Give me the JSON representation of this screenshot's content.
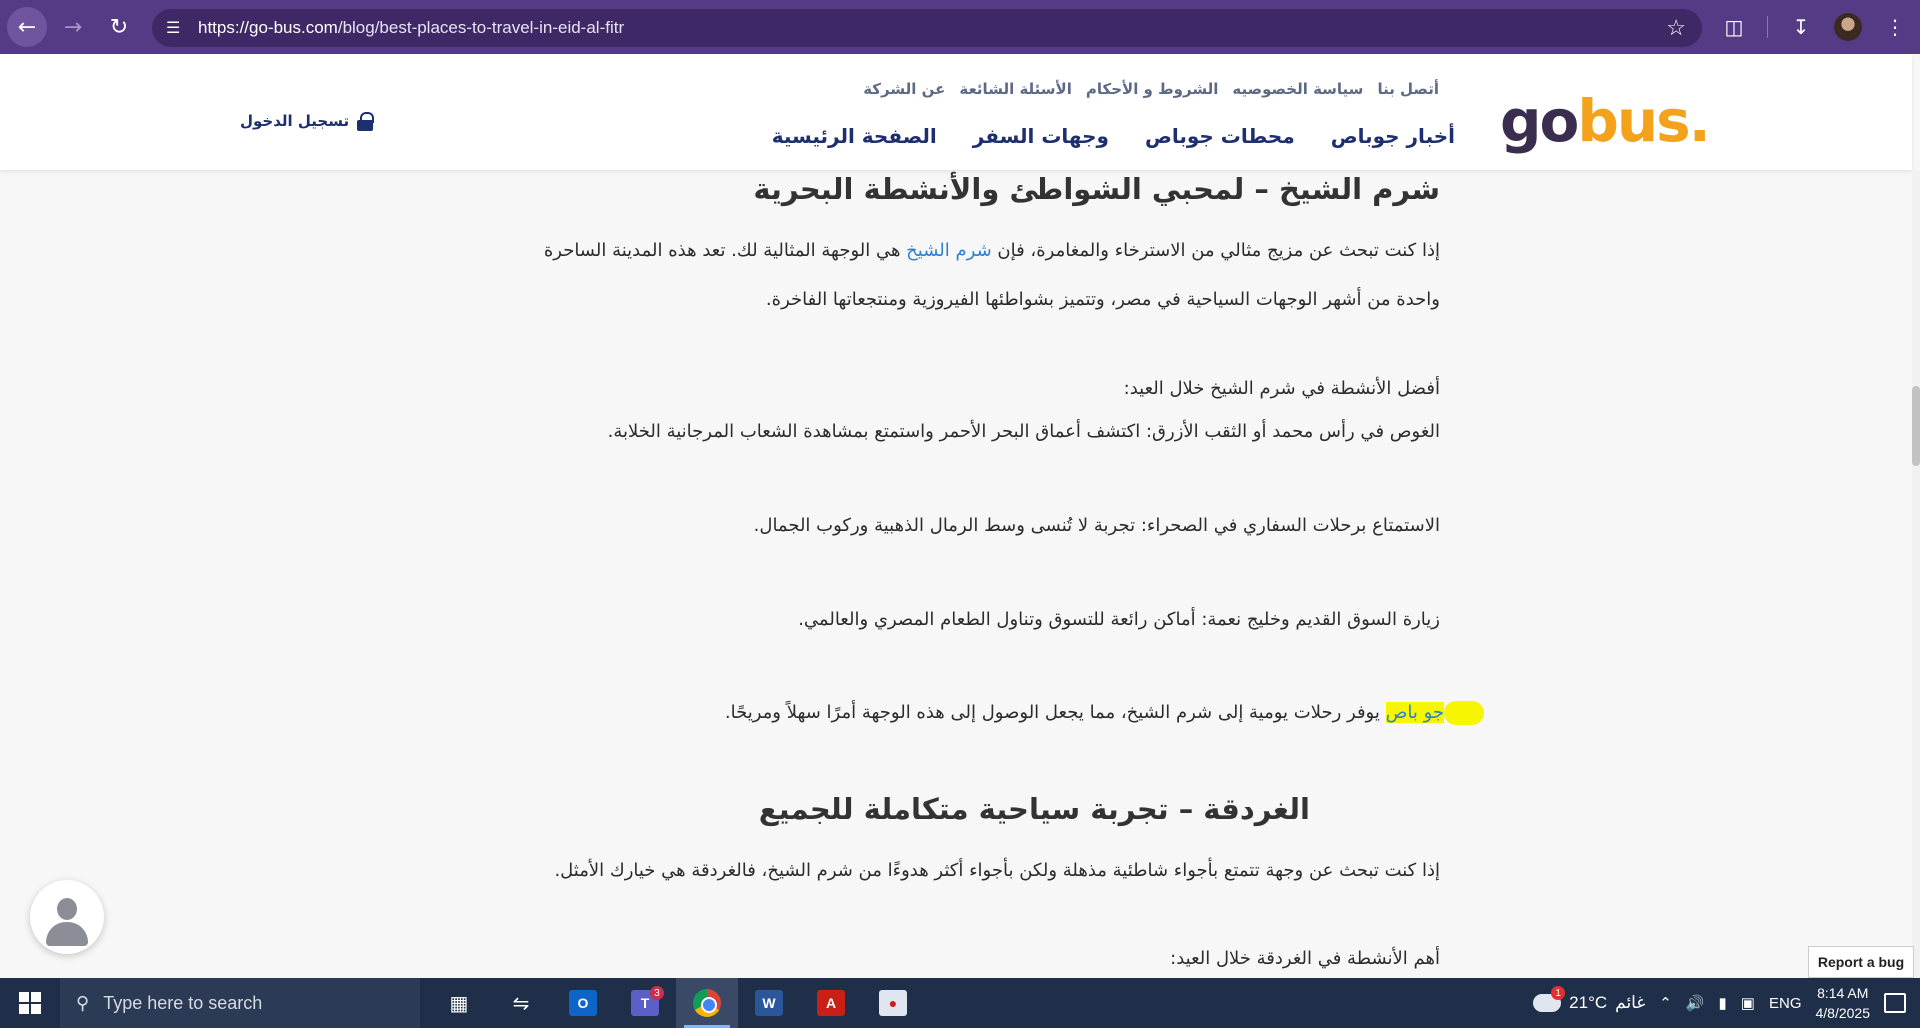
{
  "browser": {
    "url_host": "https://go-bus.com",
    "url_path": "/blog/best-places-to-travel-in-eid-al-fitr",
    "back_icon": "arrow-left-icon",
    "forward_icon": "arrow-right-icon",
    "reload_icon": "reload-icon"
  },
  "header": {
    "logo_go": "go",
    "logo_bus": "bus.",
    "top_links": [
      "عن الشركة",
      "الأسئلة الشائعة",
      "الشروط و الأحكام",
      "سياسة الخصوصيه",
      "أتصل بنا"
    ],
    "nav": [
      "الصفحة الرئيسية",
      "وجهات السفر",
      "محطات جوباص",
      "أخبار جوباص"
    ],
    "login_label": "تسجيل الدخول"
  },
  "article": {
    "h_sharm": "شرم الشيخ – لمحبي الشواطئ والأنشطة البحرية",
    "p1_a": "إذا كنت تبحث عن مزيج مثالي من الاسترخاء والمغامرة، فإن ",
    "p1_link": "شرم الشيخ",
    "p1_b": " هي الوجهة المثالية لك. تعد هذه المدينة الساحرة",
    "p2": "واحدة من أشهر الوجهات السياحية في مصر، وتتميز بشواطئها الفيروزية ومنتجعاتها الفاخرة.",
    "activities_heading": "أفضل الأنشطة في شرم الشيخ خلال العيد:",
    "activity_1": "الغوص في رأس محمد أو الثقب الأزرق: اكتشف أعماق البحر الأحمر واستمتع بمشاهدة الشعاب المرجانية الخلابة.",
    "activity_2": "الاستمتاع برحلات السفاري في الصحراء: تجربة لا تُنسى وسط الرمال الذهبية وركوب الجمال.",
    "activity_3": "زيارة السوق القديم وخليج نعمة: أماكن رائعة للتسوق وتناول الطعام المصري والعالمي.",
    "gobus_link": "جو باص",
    "gobus_text": " يوفر رحلات يومية إلى شرم الشيخ، مما يجعل الوصول إلى هذه الوجهة أمرًا سهلاً ومريحًا.",
    "h_hurghada": "الغردقة – تجربة سياحية متكاملة للجميع",
    "p_hurghada": "إذا كنت تبحث عن وجهة تتمتع بأجواء شاطئية مذهلة ولكن بأجواء أكثر هدوءًا من شرم الشيخ، فالغردقة هي خيارك الأمثل.",
    "hurghada_activities": "أهم الأنشطة في الغردقة خلال العيد:"
  },
  "widgets": {
    "report_bug": "Report a bug"
  },
  "taskbar": {
    "search_placeholder": "Type here to search",
    "teams_badge": "3",
    "weather_temp": "21°C",
    "weather_desc": "غائم",
    "weather_badge": "1",
    "lang": "ENG",
    "time": "8:14 AM",
    "date": "4/8/2025"
  },
  "colors": {
    "browser_bar": "#553a86",
    "brand_dark": "#3b2d4e",
    "brand_orange": "#f4a11c",
    "nav_blue": "#1d2f6e",
    "link_blue": "#2f7fd2",
    "highlight": "#f6f600"
  }
}
